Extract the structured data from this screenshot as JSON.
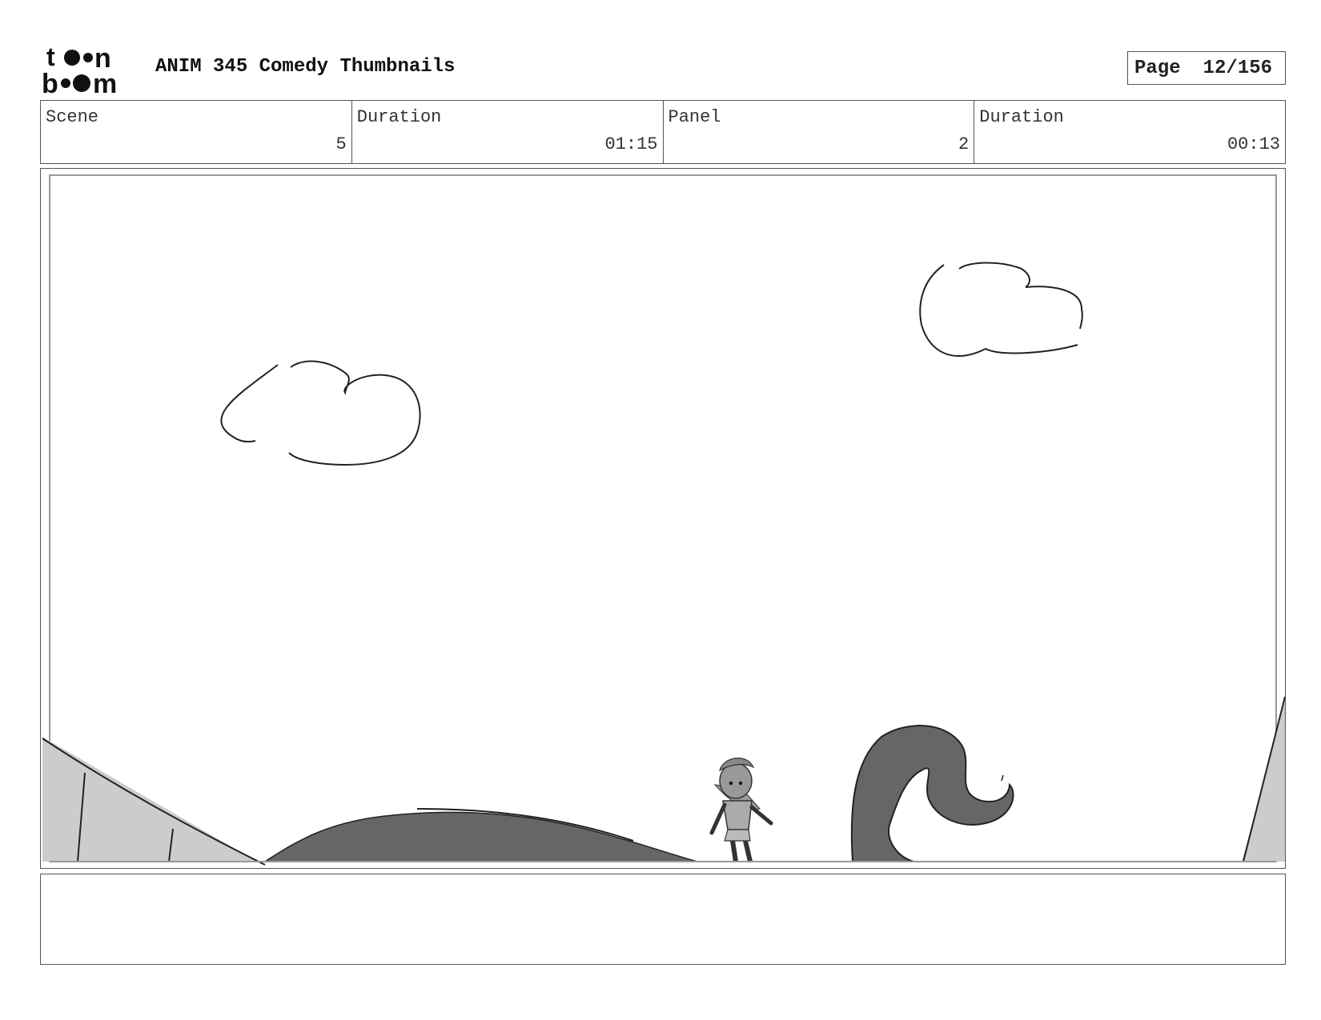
{
  "header": {
    "logo_text": "toon boom",
    "title": "ANIM 345 Comedy Thumbnails",
    "page_label": "Page",
    "page_value": "12/156"
  },
  "info": {
    "scene_label": "Scene",
    "scene_value": "5",
    "scene_duration_label": "Duration",
    "scene_duration_value": "01:15",
    "panel_label": "Panel",
    "panel_value": "2",
    "panel_duration_label": "Duration",
    "panel_duration_value": "00:13"
  },
  "colors": {
    "border": "#555555",
    "dark_fill": "#666666",
    "light_fill": "#cccccc",
    "figure_fill": "#999999"
  },
  "notes": {
    "text": ""
  }
}
